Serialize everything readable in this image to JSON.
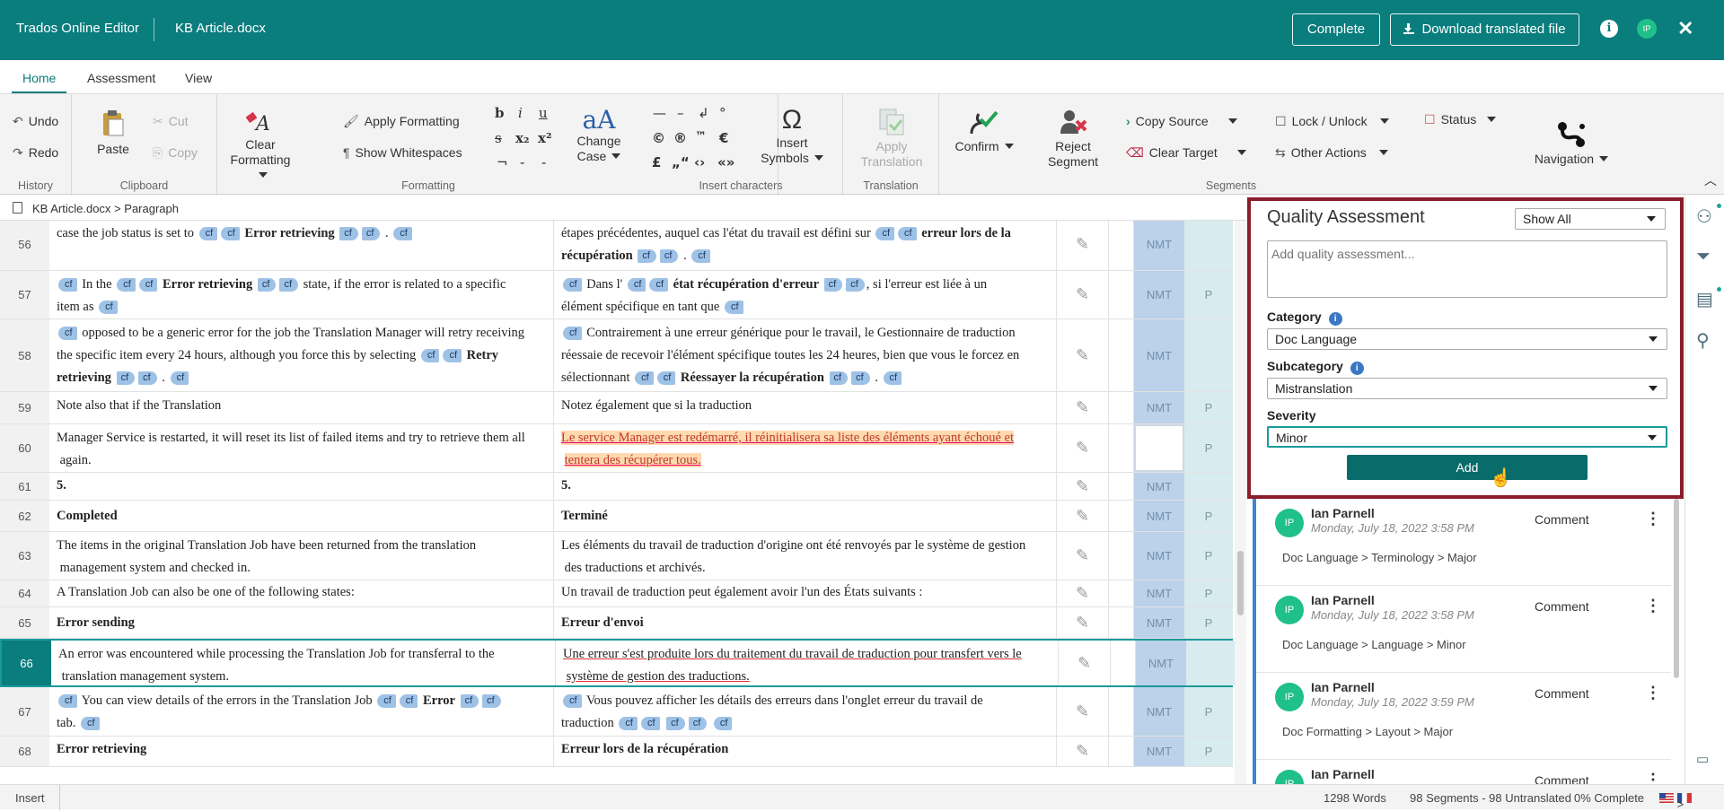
{
  "header": {
    "app_title": "Trados Online Editor",
    "file_name": "KB Article.docx",
    "complete_label": "Complete",
    "download_label": "Download translated file",
    "user_initials": "IP"
  },
  "tabs": [
    "Home",
    "Assessment",
    "View"
  ],
  "ribbon": {
    "history": {
      "undo": "Undo",
      "redo": "Redo",
      "label": "History"
    },
    "clipboard": {
      "paste": "Paste",
      "cut": "Cut",
      "copy": "Copy",
      "label": "Clipboard"
    },
    "clear_formatting": "Clear Formatting",
    "formatting": {
      "apply": "Apply Formatting",
      "whitespaces": "Show Whitespaces",
      "label": "Formatting"
    },
    "change_case": "Change Case",
    "insert_chars": {
      "label": "Insert characters",
      "row1": [
        "—",
        "–",
        "↲",
        "°"
      ],
      "row2": [
        "©",
        "®",
        "™",
        "€"
      ],
      "row3": [
        "£",
        "„“",
        "‹›",
        "«»"
      ],
      "insert_symbols": "Insert Symbols"
    },
    "translation": {
      "apply": "Apply Translation",
      "label": "Translation"
    },
    "segments": {
      "confirm": "Confirm",
      "reject": "Reject Segment",
      "copy_source": "Copy Source",
      "clear_target": "Clear Target",
      "lock_unlock": "Lock / Unlock",
      "other_actions": "Other Actions",
      "status": "Status",
      "label": "Segments"
    },
    "navigation": "Navigation",
    "format_letters": {
      "bold": "b",
      "italic": "i",
      "underline": "u",
      "strike": "s",
      "sub": "x₂",
      "sup": "x²",
      "misc": [
        "¬",
        "-",
        "-"
      ]
    }
  },
  "breadcrumb": {
    "doc": "KB Article.docx",
    "sep": ">",
    "node": "Paragraph"
  },
  "rows": [
    {
      "num": "56",
      "status": "NMT",
      "p": ""
    },
    {
      "num": "57",
      "status": "NMT",
      "p": "P"
    },
    {
      "num": "58",
      "status": "NMT",
      "p": ""
    },
    {
      "num": "59",
      "status": "NMT",
      "p": "P"
    },
    {
      "num": "60",
      "status": "",
      "p": "P"
    },
    {
      "num": "61",
      "status": "NMT",
      "p": ""
    },
    {
      "num": "62",
      "status": "NMT",
      "p": "P"
    },
    {
      "num": "63",
      "status": "NMT",
      "p": "P"
    },
    {
      "num": "64",
      "status": "NMT",
      "p": "P"
    },
    {
      "num": "65",
      "status": "NMT",
      "p": "P"
    },
    {
      "num": "66",
      "status": "NMT",
      "p": ""
    },
    {
      "num": "67",
      "status": "NMT",
      "p": "P"
    },
    {
      "num": "68",
      "status": "NMT",
      "p": "P"
    }
  ],
  "segments": {
    "tag": "cf",
    "r56": {
      "src_a": "case the job status is set to",
      "src_b": "Error retrieving",
      "tgt_a": "étapes précédentes, auquel cas l'état du travail est défini sur",
      "tgt_b": "erreur lors de la",
      "tgt_c": "récupération"
    },
    "r57": {
      "src_a": "In the",
      "src_b": "Error retrieving",
      "src_c": "state, if the error is related to a specific",
      "src_d": "item as",
      "tgt_a": "Dans l'",
      "tgt_b": "état récupération d'erreur",
      "tgt_c": ", si l'erreur est liée à un",
      "tgt_d": "élément spécifique en tant que"
    },
    "r58": {
      "src_a": "opposed to be a generic error for the job the Translation Manager will retry receiving",
      "src_b": "the specific item every 24 hours, although you force this by selecting",
      "src_c": "Retry",
      "src_d": "retrieving",
      "tgt_a": "Contrairement à une erreur générique pour le travail, le Gestionnaire de traduction",
      "tgt_b": "réessaie de recevoir l'élément spécifique toutes les 24 heures, bien que vous le forcez en",
      "tgt_c": "sélectionnant",
      "tgt_d": "Réessayer la récupération"
    },
    "r59": {
      "src": "Note also that if the Translation",
      "tgt": "Notez également que si la traduction"
    },
    "r60": {
      "src_a": "Manager Service is restarted, it will reset its list of failed items and try to retrieve them all",
      "src_b": "again.",
      "tgt_a": "Le service Manager est redémarré, il réinitialisera sa liste des éléments ayant échoué et",
      "tgt_b": "tentera des récupérer tous."
    },
    "r61": {
      "src": "5.",
      "tgt": "5."
    },
    "r62": {
      "src": "Completed",
      "tgt": "Terminé"
    },
    "r63": {
      "src_a": "The items in the original Translation Job have been returned from the translation",
      "src_b": "management system and checked in.",
      "tgt_a": "Les éléments du travail de traduction d'origine ont été renvoyés par le système de gestion",
      "tgt_b": "des traductions et archivés."
    },
    "r64": {
      "src": "A Translation Job can also be one of the following states:",
      "tgt": "Un travail de traduction peut également avoir l'un des États suivants :"
    },
    "r65": {
      "src": "Error sending",
      "tgt": "Erreur d'envoi"
    },
    "r66": {
      "src_a": "An error was encountered while processing the Translation Job for transferral to the",
      "src_b": "translation management system.",
      "tgt_a": "Une erreur s'est produite lors du traitement du travail de traduction pour transfert vers le",
      "tgt_b": "système de gestion des traductions."
    },
    "r67": {
      "src_a": "You can view details of the errors in the Translation Job",
      "src_b": "Error",
      "src_c": "tab.",
      "tgt_a": "Vous pouvez afficher les détails des erreurs dans l'onglet erreur du travail de",
      "tgt_b": "traduction"
    },
    "r68": {
      "src": "Error retrieving",
      "tgt": "Erreur lors de la récupération"
    }
  },
  "qa": {
    "title": "Quality Assessment",
    "filter": "Show All",
    "placeholder": "Add quality assessment...",
    "category_label": "Category",
    "category": "Doc Language",
    "subcategory_label": "Subcategory",
    "subcategory": "Mistranslation",
    "severity_label": "Severity",
    "severity": "Minor",
    "add_label": "Add"
  },
  "comments": [
    {
      "initials": "IP",
      "name": "Ian Parnell",
      "date": "Monday, July 18, 2022 3:58 PM",
      "label": "Comment",
      "path": "Doc Language  >  Terminology  >  Major"
    },
    {
      "initials": "IP",
      "name": "Ian Parnell",
      "date": "Monday, July 18, 2022 3:58 PM",
      "label": "Comment",
      "path": "Doc Language  >  Language  >  Minor"
    },
    {
      "initials": "IP",
      "name": "Ian Parnell",
      "date": "Monday, July 18, 2022 3:59 PM",
      "label": "Comment",
      "path": "Doc Formatting  >  Layout  >  Major"
    },
    {
      "initials": "IP",
      "name": "Ian Parnell",
      "date": "",
      "label": "Comment",
      "path": ""
    }
  ],
  "status_bar": {
    "mode": "Insert",
    "words": "1298 Words",
    "segments": "98 Segments - 98 Untranslated",
    "complete": "0% Complete",
    "arrow": ">"
  },
  "colors": {
    "brand": "#0a7d7d",
    "highlight_border": "#8b1c2c",
    "tag": "#9ec1e6",
    "nmt": "#bcd1ea"
  }
}
